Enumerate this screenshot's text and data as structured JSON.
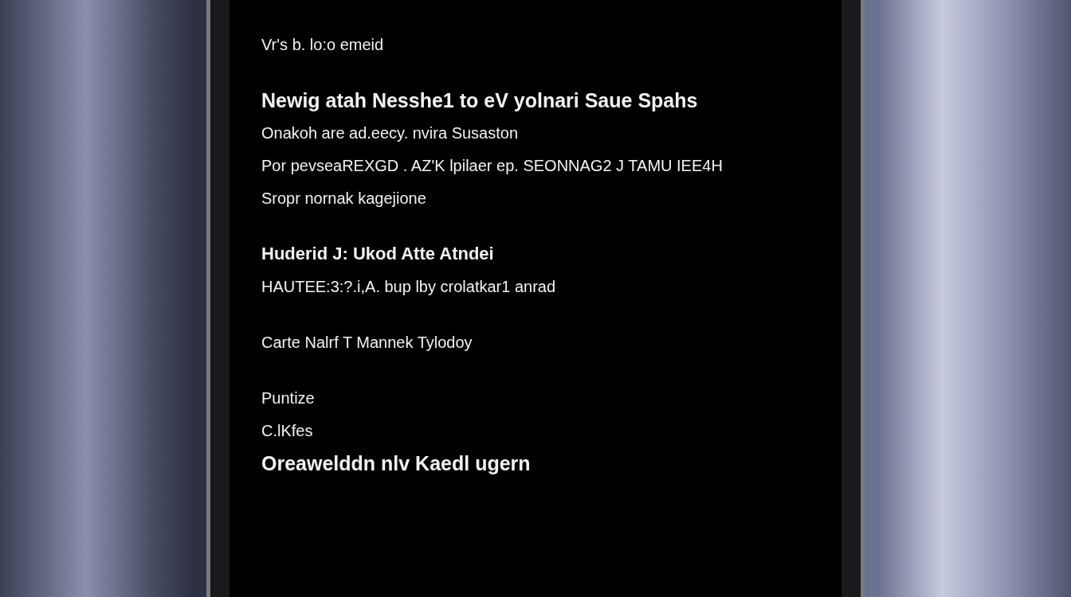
{
  "screen": {
    "sections": [
      {
        "lines": [
          {
            "text": "Vr's b. lo:o emeid",
            "kind": "body"
          }
        ]
      },
      {
        "lines": [
          {
            "text": "Newig atah Nesshe1 to eV yolnari Saue Spahs",
            "kind": "title"
          },
          {
            "text": "Onakoh are ad.eecy. nvira Susaston",
            "kind": "body"
          },
          {
            "text": "Por pevseaREXGD . AZ'K lpilaer ep. SEONNAG2 J TAMU IEE4H",
            "kind": "body"
          },
          {
            "text": "Sropr nornak kagejione",
            "kind": "body"
          }
        ]
      },
      {
        "lines": [
          {
            "text": "Huderid J: Ukod Atte Atndei",
            "kind": "heading"
          },
          {
            "text": "HAUTEE:3:?.i,A. bup lby crolatkar1 anrad",
            "kind": "body"
          }
        ]
      },
      {
        "lines": [
          {
            "text": "Carte Nalrf T Mannek Tylodoy",
            "kind": "body"
          }
        ]
      },
      {
        "lines": [
          {
            "text": "Puntize",
            "kind": "body"
          },
          {
            "text": "C.lKfes",
            "kind": "body"
          },
          {
            "text": "Oreawelddn nlv Kaedl ugern",
            "kind": "title"
          }
        ]
      }
    ]
  }
}
